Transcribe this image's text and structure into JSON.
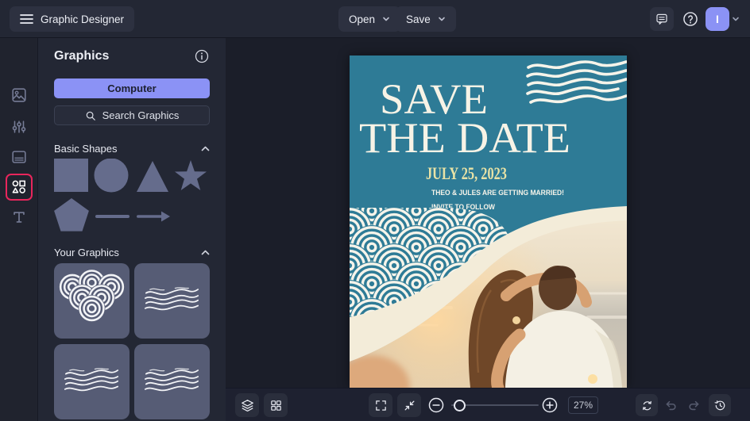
{
  "topbar": {
    "app_title": "Graphic Designer",
    "open_label": "Open",
    "save_label": "Save",
    "avatar_initial": "I"
  },
  "rail": {
    "items": [
      "image-icon",
      "adjustments-icon",
      "templates-icon",
      "shapes-icon",
      "text-icon"
    ],
    "active_item": "shapes-icon"
  },
  "panel": {
    "title": "Graphics",
    "computer_button_label": "Computer",
    "search_button_label": "Search Graphics",
    "basic_shapes": {
      "title": "Basic Shapes",
      "shapes": [
        "square",
        "circle",
        "triangle",
        "star",
        "pentagon",
        "line",
        "arrow"
      ]
    },
    "your_graphics": {
      "title": "Your Graphics",
      "tiles": [
        "seigaiha-cluster",
        "wavy-lines",
        "wavy-lines",
        "wavy-lines"
      ]
    }
  },
  "design": {
    "heading_line1": "SAVE",
    "heading_line2": "THE DATE",
    "date": "JULY 25, 2023",
    "announcement": "THEO & JULES ARE GETTING MARRIED!",
    "note": "INVITE TO FOLLOW"
  },
  "toolbar": {
    "zoom_value": "27%",
    "icons": [
      "layers",
      "grid",
      "fullscreen",
      "fit-to-screen",
      "zoom-out",
      "zoom-slider",
      "zoom-in",
      "reset",
      "undo",
      "redo",
      "history"
    ]
  },
  "colors": {
    "accent_purple": "#8b92f5",
    "highlight_red": "#e8265c",
    "design_teal": "#2e7b96",
    "design_cream": "#f3ecd9",
    "date_yellow": "#e9e3a6",
    "design_ink": "#f6f4ea"
  }
}
